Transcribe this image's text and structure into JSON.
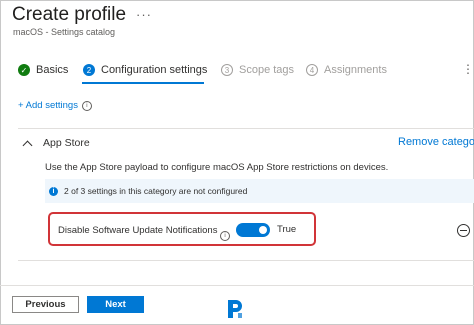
{
  "header": {
    "title": "Create profile",
    "more": "···",
    "subtitle": "macOS - Settings catalog"
  },
  "steps": [
    {
      "number": "✓",
      "label": "Basics",
      "state": "done"
    },
    {
      "number": "2",
      "label": "Configuration settings",
      "state": "active"
    },
    {
      "number": "3",
      "label": "Scope tags",
      "state": "todo"
    },
    {
      "number": "4",
      "label": "Assignments",
      "state": "todo"
    }
  ],
  "more_right": "⋮",
  "add_settings": {
    "label": "+ Add settings",
    "info": "i"
  },
  "category": {
    "name": "App Store",
    "remove_label": "Remove category",
    "description": "Use the App Store payload to configure macOS App Store restrictions on devices.",
    "banner": {
      "icon": "i",
      "text": "2 of 3 settings in this category are not configured"
    }
  },
  "setting": {
    "label": "Disable Software Update Notifications",
    "info": "i",
    "toggle_on": true,
    "value_text": "True"
  },
  "footer": {
    "previous_label": "Previous",
    "next_label": "Next"
  },
  "colors": {
    "accent": "#0078d4",
    "success": "#107c10",
    "highlight": "#d13438"
  },
  "icons": [
    "checkmark-icon",
    "info-icon",
    "chevron-up-icon",
    "minus-circle-icon",
    "more-icon",
    "logo-icon"
  ]
}
